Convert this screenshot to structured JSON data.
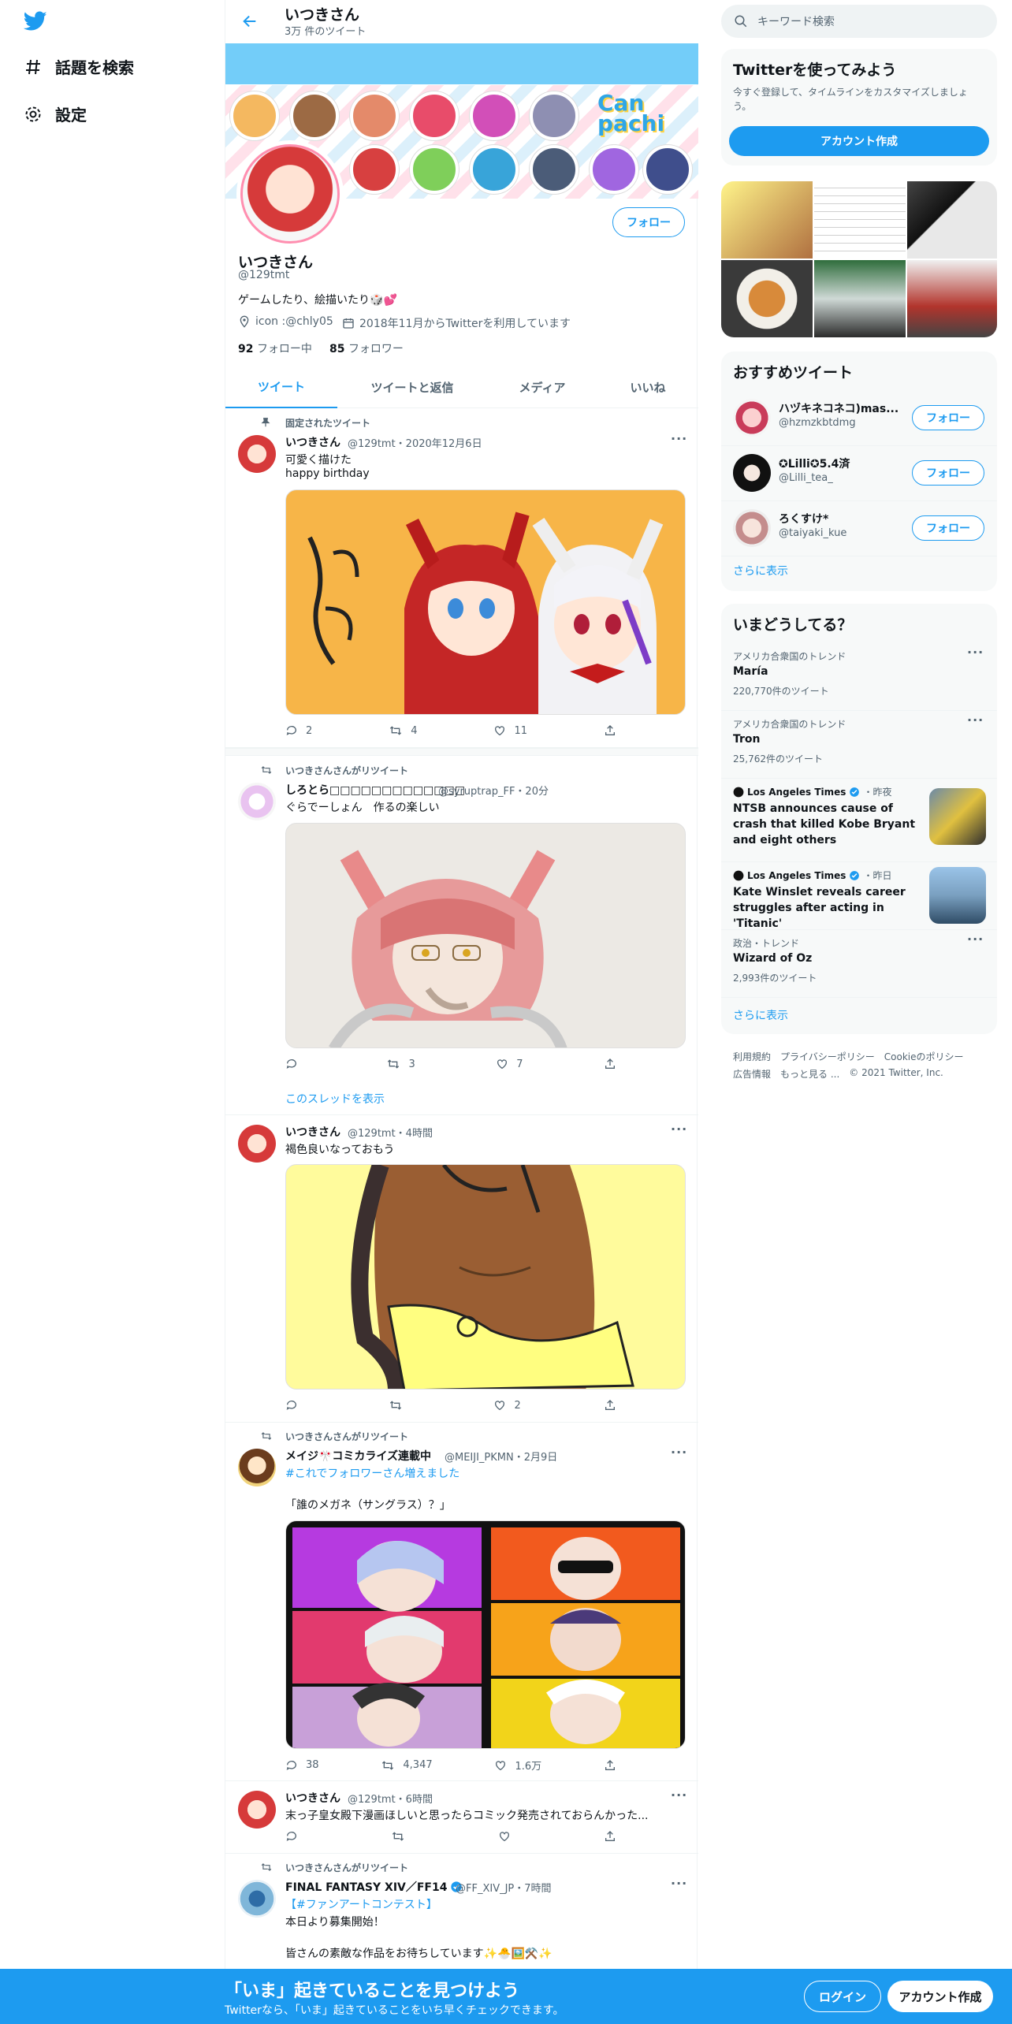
{
  "nav": {
    "explore_label": "話題を検索",
    "settings_label": "設定"
  },
  "header": {
    "title": "いつきさん",
    "subtitle": "3万 件のツイート"
  },
  "profile": {
    "name": "いつきさん",
    "handle": "@129tmt",
    "bio": "ゲームしたり、絵描いたり🎲💕",
    "location": "icon :@chly05",
    "joined": "2018年11月からTwitterを利用しています",
    "following_count": "92",
    "following_label": "フォロー中",
    "followers_count": "85",
    "followers_label": "フォロワー",
    "follow_button": "フォロー",
    "canpachi_logo": "Can pachi"
  },
  "tabs": [
    "ツイート",
    "ツイートと返信",
    "メディア",
    "いいね"
  ],
  "tweets": {
    "t1": {
      "pinned": "固定されたツイート",
      "name": "いつきさん",
      "meta": "@129tmt・2020年12月6日",
      "text1": "可愛く描けた",
      "text2": "happy birthday",
      "replies": "2",
      "retweets": "4",
      "likes": "11"
    },
    "t2": {
      "rt_label": "いつきさんさんがリツイート",
      "name": "しろとら□□□□□□□□□□□□□",
      "meta": "@syruptrap_FF・20分",
      "text": "ぐらでーしょん　作るの楽しい",
      "replies": "",
      "retweets": "3",
      "likes": "7",
      "thread": "このスレッドを表示"
    },
    "t3": {
      "name": "いつきさん",
      "meta": "@129tmt・4時間",
      "text": "褐色良いなっておもう",
      "replies": "",
      "retweets": "",
      "likes": "2"
    },
    "t4": {
      "rt_label": "いつきさんさんがリツイート",
      "name": "メイジ🎌コミカライズ連載中",
      "meta": "@MEIJI_PKMN・2月9日",
      "hashtag": "#これでフォロワーさん増えました",
      "text": "「誰のメガネ（サングラス）？」",
      "replies": "38",
      "retweets": "4,347",
      "likes": "1.6万"
    },
    "t5": {
      "name": "いつきさん",
      "meta": "@129tmt・6時間",
      "text": "末っ子皇女殿下漫画ほしいと思ったらコミック発売されておらんかった..."
    },
    "t6": {
      "rt_label": "いつきさんさんがリツイート",
      "name": "FINAL FANTASY XIV／FF14",
      "meta": "@FF_XIV_JP・7時間",
      "hashtag": "【#ファンアートコンテスト】",
      "text1": "本日より募集開始！",
      "text2": "皆さんの素敵な作品をお待ちしています✨🐣🖼️⚒️✨"
    }
  },
  "sidebar": {
    "search_placeholder": "キーワード検索",
    "signup_title": "Twitterを使ってみよう",
    "signup_desc": "今すぐ登録して、タイムラインをカスタマイズしましょう。",
    "signup_button": "アカウント作成",
    "recommend_title": "おすすめツイート",
    "follow_label": "フォロー",
    "users": [
      {
        "name": "ハヅキネコネコ)mas...",
        "handle": "@hzmzkbtdmg"
      },
      {
        "name": "✪Lilli✪5.4済",
        "handle": "@Lilli_tea_"
      },
      {
        "name": "ろくすけ*",
        "handle": "@taiyaki_kue"
      }
    ],
    "show_more": "さらに表示",
    "trends_title": "いまどうしてる？",
    "trends": [
      {
        "context": "アメリカ合衆国のトレンド",
        "title": "María",
        "count": "220,770件のツイート"
      },
      {
        "context": "アメリカ合衆国のトレンド",
        "title": "Tron",
        "count": "25,762件のツイート"
      }
    ],
    "news": [
      {
        "source": "Los Angeles Times",
        "time": "・昨夜",
        "title": "NTSB announces cause of crash that killed Kobe Bryant and eight others"
      },
      {
        "source": "Los Angeles Times",
        "time": "・昨日",
        "title": "Kate Winslet reveals career struggles after acting in 'Titanic'"
      }
    ],
    "trend3": {
      "context": "政治・トレンド",
      "title": "Wizard of Oz",
      "count": "2,993件のツイート"
    },
    "footer1": [
      "利用規約",
      "プライバシーポリシー",
      "Cookieのポリシー"
    ],
    "footer2": [
      "広告情報",
      "もっと見る ...",
      "© 2021 Twitter, Inc."
    ]
  },
  "bottom": {
    "title": "「いま」起きていることを見つけよう",
    "sub": "Twitterなら、「いま」起きていることをいち早くチェックできます。",
    "login": "ログイン",
    "signup": "アカウント作成"
  },
  "colors": {
    "accent": "#1d9bf0",
    "banner": "#73cdf9"
  }
}
